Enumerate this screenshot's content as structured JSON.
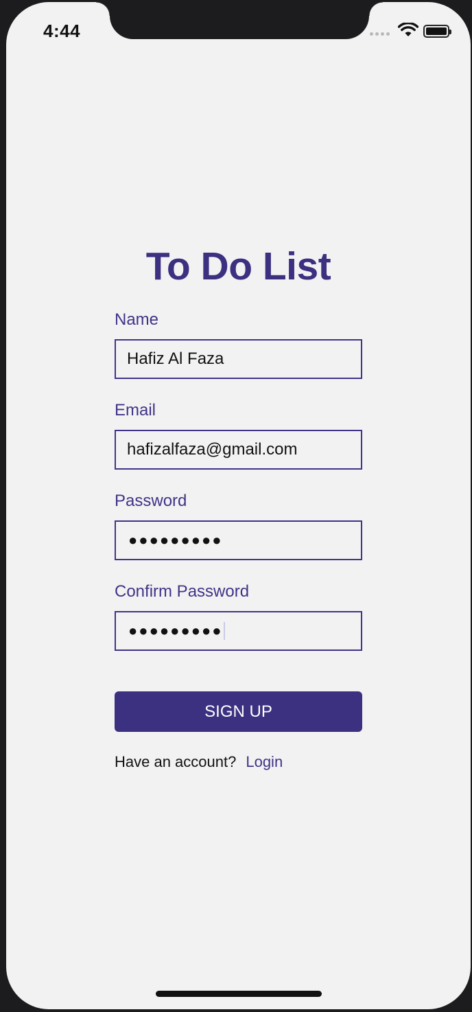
{
  "status_bar": {
    "time": "4:44",
    "icons": [
      "signal-icon",
      "wifi-icon",
      "battery-icon"
    ]
  },
  "title": "To Do List",
  "form": {
    "name_label": "Name",
    "name_value": "Hafiz Al Faza",
    "email_label": "Email",
    "email_value": "hafizalfaza@gmail.com",
    "password_label": "Password",
    "password_value": "●●●●●●●●●",
    "confirm_label": "Confirm Password",
    "confirm_value": "●●●●●●●●●"
  },
  "signup_label": "SIGN UP",
  "footer": {
    "prompt": "Have an account?",
    "login_link": "Login"
  },
  "colors": {
    "accent": "#3b3180",
    "background": "#f2f2f2"
  }
}
